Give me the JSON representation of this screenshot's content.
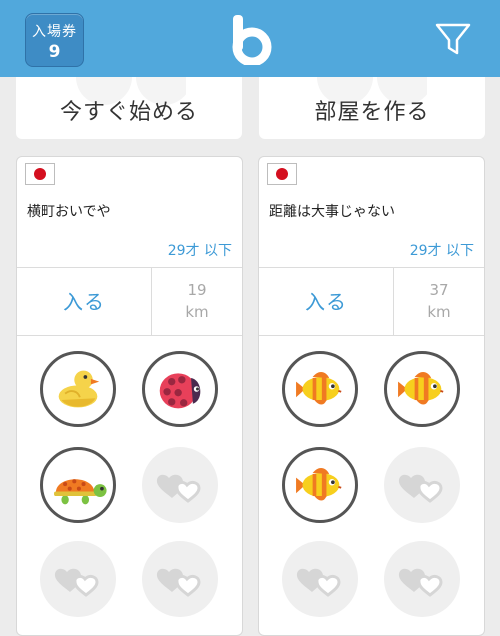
{
  "header": {
    "ticket_label": "入場券",
    "ticket_count": "9",
    "logo_icon": "b-logo-icon",
    "filter_icon": "filter-icon",
    "color": "#51a8dc"
  },
  "top_buttons": {
    "start_now": "今すぐ始める",
    "create_room": "部屋を作る"
  },
  "rooms": [
    {
      "flag_icon": "japan-flag-icon",
      "name": "横町おいでや",
      "age": "29才 以下",
      "enter_label": "入る",
      "distance_value": "19",
      "distance_unit": "km",
      "slots": [
        "duck-avatar-icon",
        "ladybug-avatar-icon",
        "turtle-avatar-icon",
        "empty-heart-icon",
        "empty-heart-icon",
        "empty-heart-icon"
      ]
    },
    {
      "flag_icon": "japan-flag-icon",
      "name": "距離は大事じゃない",
      "age": "29才 以下",
      "enter_label": "入る",
      "distance_value": "37",
      "distance_unit": "km",
      "slots": [
        "fish-avatar-icon",
        "fish-avatar-icon",
        "fish-avatar-icon",
        "empty-heart-icon",
        "empty-heart-icon",
        "empty-heart-icon"
      ]
    }
  ],
  "colors": {
    "accent": "#3d9ad6",
    "flag_red": "#d40f1f"
  }
}
